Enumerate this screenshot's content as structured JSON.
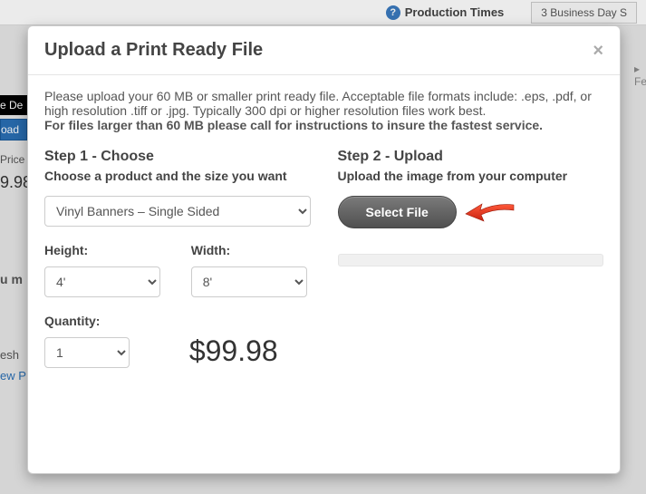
{
  "bg": {
    "production_times": "Production Times",
    "biz_days": "3 Business Day S",
    "fe": "▸ Fe",
    "details": "e De",
    "load": "oad",
    "price": "Price",
    "pricevalue": "9.98",
    "um": "u m",
    "esh": "esh",
    "ewp": "ew P"
  },
  "modal": {
    "title": "Upload a Print Ready File",
    "instructions_line1": "Please upload your 60 MB or smaller print ready file. Acceptable file formats include: .eps, .pdf, or high resolution .tiff or .jpg. Typically 300 dpi or higher resolution files work best.",
    "instructions_line2": "For files larger than 60 MB please call for instructions to insure the fastest service.",
    "step1": {
      "heading": "Step 1 - Choose",
      "subtitle": "Choose a product and the size you want",
      "product_selected": "Vinyl Banners – Single Sided",
      "height_label": "Height:",
      "height_value": "4'",
      "width_label": "Width:",
      "width_value": "8'",
      "quantity_label": "Quantity:",
      "quantity_value": "1",
      "price": "$99.98"
    },
    "step2": {
      "heading": "Step 2 - Upload",
      "subtitle": "Upload the image from your computer",
      "button": "Select File"
    }
  }
}
